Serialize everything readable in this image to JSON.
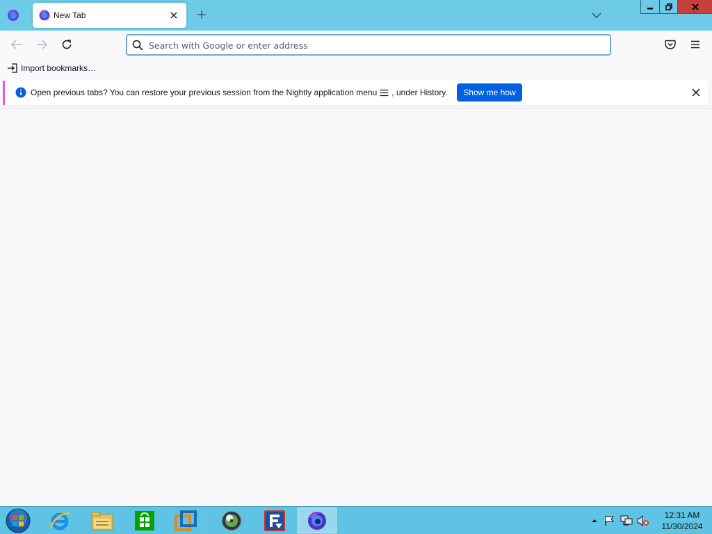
{
  "browser": {
    "tab": {
      "title": "New Tab"
    },
    "urlbar": {
      "placeholder": "Search with Google or enter address",
      "value": ""
    },
    "bookmarks": {
      "import_label": "Import bookmarks…"
    },
    "notification": {
      "message_before": "Open previous tabs? You can restore your previous session from the Nightly application menu",
      "message_after": ", under History.",
      "button_label": "Show me how"
    }
  },
  "taskbar": {
    "apps": [
      "internet-explorer-icon",
      "file-explorer-icon",
      "store-icon",
      "virtualbox-icon",
      "media-player-icon",
      "filezilla-icon",
      "firefox-nightly-icon"
    ],
    "clock": {
      "time": "12:31 AM",
      "date": "11/30/2024"
    }
  },
  "colors": {
    "tabstrip": "#6ecbe8",
    "accent": "#0061e0",
    "notification_border": "#e65bd8",
    "taskbar": "#5fc4e4",
    "close_button": "#c5403b"
  }
}
